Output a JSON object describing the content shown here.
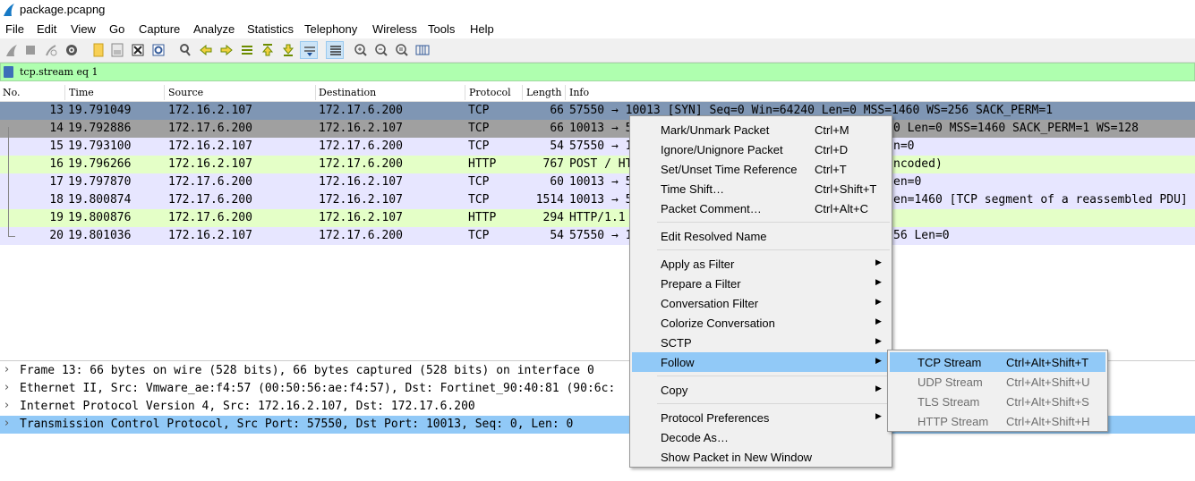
{
  "window": {
    "title": "package.pcapng"
  },
  "menu": [
    "File",
    "Edit",
    "View",
    "Go",
    "Capture",
    "Analyze",
    "Statistics",
    "Telephony",
    "Wireless",
    "Tools",
    "Help"
  ],
  "toolbar_icons": [
    "shark-fin-start-icon",
    "stop-icon",
    "restart-icon",
    "capture-options-icon",
    "open-file-icon",
    "save-file-icon",
    "close-file-icon",
    "reload-icon",
    "find-packet-icon",
    "go-back-icon",
    "go-forward-icon",
    "go-to-packet-icon",
    "first-packet-icon",
    "last-packet-icon",
    "autoscroll-icon",
    "colorize-icon",
    "zoom-in-icon",
    "zoom-out-icon",
    "normal-size-icon",
    "resize-columns-icon"
  ],
  "filter": {
    "value": "tcp.stream eq 1"
  },
  "columns": {
    "no": "No.",
    "time": "Time",
    "source": "Source",
    "destination": "Destination",
    "protocol": "Protocol",
    "length": "Length",
    "info": "Info"
  },
  "packets": [
    {
      "no": "13",
      "time": "19.791049",
      "src": "172.16.2.107",
      "dst": "172.17.6.200",
      "proto": "TCP",
      "len": "66",
      "info": "57550 → 10013 [SYN] Seq=0 Win=64240 Len=0 MSS=1460 WS=256 SACK_PERM=1",
      "bg": "#7f96b4"
    },
    {
      "no": "14",
      "time": "19.792886",
      "src": "172.17.6.200",
      "dst": "172.16.2.107",
      "proto": "TCP",
      "len": "66",
      "info": "10013 → 5",
      "info_right": "0 Len=0 MSS=1460 SACK_PERM=1 WS=128",
      "bg": "#a0a0a0"
    },
    {
      "no": "15",
      "time": "19.793100",
      "src": "172.16.2.107",
      "dst": "172.17.6.200",
      "proto": "TCP",
      "len": "54",
      "info": "57550 → 1",
      "info_right": "n=0",
      "bg": "#e7e6ff"
    },
    {
      "no": "16",
      "time": "19.796266",
      "src": "172.16.2.107",
      "dst": "172.17.6.200",
      "proto": "HTTP",
      "len": "767",
      "info": "POST / HT",
      "info_right": "ncoded)",
      "bg": "#e4ffc7"
    },
    {
      "no": "17",
      "time": "19.797870",
      "src": "172.17.6.200",
      "dst": "172.16.2.107",
      "proto": "TCP",
      "len": "60",
      "info": "10013 → 5",
      "info_right": "en=0",
      "bg": "#e7e6ff"
    },
    {
      "no": "18",
      "time": "19.800874",
      "src": "172.17.6.200",
      "dst": "172.16.2.107",
      "proto": "TCP",
      "len": "1514",
      "info": "10013 → 5",
      "info_right": "en=1460 [TCP segment of a reassembled PDU]",
      "bg": "#e7e6ff"
    },
    {
      "no": "19",
      "time": "19.800876",
      "src": "172.17.6.200",
      "dst": "172.16.2.107",
      "proto": "HTTP",
      "len": "294",
      "info": "HTTP/1.1",
      "info_right": "",
      "bg": "#e4ffc7"
    },
    {
      "no": "20",
      "time": "19.801036",
      "src": "172.16.2.107",
      "dst": "172.17.6.200",
      "proto": "TCP",
      "len": "54",
      "info": "57550 → 1",
      "info_right": "56 Len=0",
      "bg": "#e7e6ff"
    }
  ],
  "details": [
    {
      "text": "Frame 13: 66 bytes on wire (528 bits), 66 bytes captured (528 bits) on interface 0"
    },
    {
      "text": "Ethernet II, Src: Vmware_ae:f4:57 (00:50:56:ae:f4:57), Dst: Fortinet_90:40:81 (90:6c:"
    },
    {
      "text": "Internet Protocol Version 4, Src: 172.16.2.107, Dst: 172.17.6.200"
    },
    {
      "text": "Transmission Control Protocol, Src Port: 57550, Dst Port: 10013, Seq: 0, Len: 0"
    }
  ],
  "context_menu": {
    "mark": {
      "label": "Mark/Unmark Packet",
      "shortcut": "Ctrl+M"
    },
    "ignore": {
      "label": "Ignore/Unignore Packet",
      "shortcut": "Ctrl+D"
    },
    "time_ref": {
      "label": "Set/Unset Time Reference",
      "shortcut": "Ctrl+T"
    },
    "time_shift": {
      "label": "Time Shift…",
      "shortcut": "Ctrl+Shift+T"
    },
    "comment": {
      "label": "Packet Comment…",
      "shortcut": "Ctrl+Alt+C"
    },
    "edit_resolved": {
      "label": "Edit Resolved Name"
    },
    "apply_filter": {
      "label": "Apply as Filter"
    },
    "prepare_filter": {
      "label": "Prepare a Filter"
    },
    "conv_filter": {
      "label": "Conversation Filter"
    },
    "colorize": {
      "label": "Colorize Conversation"
    },
    "sctp": {
      "label": "SCTP"
    },
    "follow": {
      "label": "Follow"
    },
    "copy": {
      "label": "Copy"
    },
    "proto_prefs": {
      "label": "Protocol Preferences"
    },
    "decode_as": {
      "label": "Decode As…"
    },
    "show_packet": {
      "label": "Show Packet in New Window"
    }
  },
  "follow_submenu": {
    "tcp": {
      "label": "TCP Stream",
      "shortcut": "Ctrl+Alt+Shift+T"
    },
    "udp": {
      "label": "UDP Stream",
      "shortcut": "Ctrl+Alt+Shift+U"
    },
    "tls": {
      "label": "TLS Stream",
      "shortcut": "Ctrl+Alt+Shift+S"
    },
    "http": {
      "label": "HTTP Stream",
      "shortcut": "Ctrl+Alt+Shift+H"
    }
  },
  "colors": {
    "selected_row": "#7f96b4",
    "highlight": "#91c9f7",
    "filter_ok": "#afffaf",
    "tcp_row": "#e7e6ff",
    "http_row": "#e4ffc7"
  }
}
